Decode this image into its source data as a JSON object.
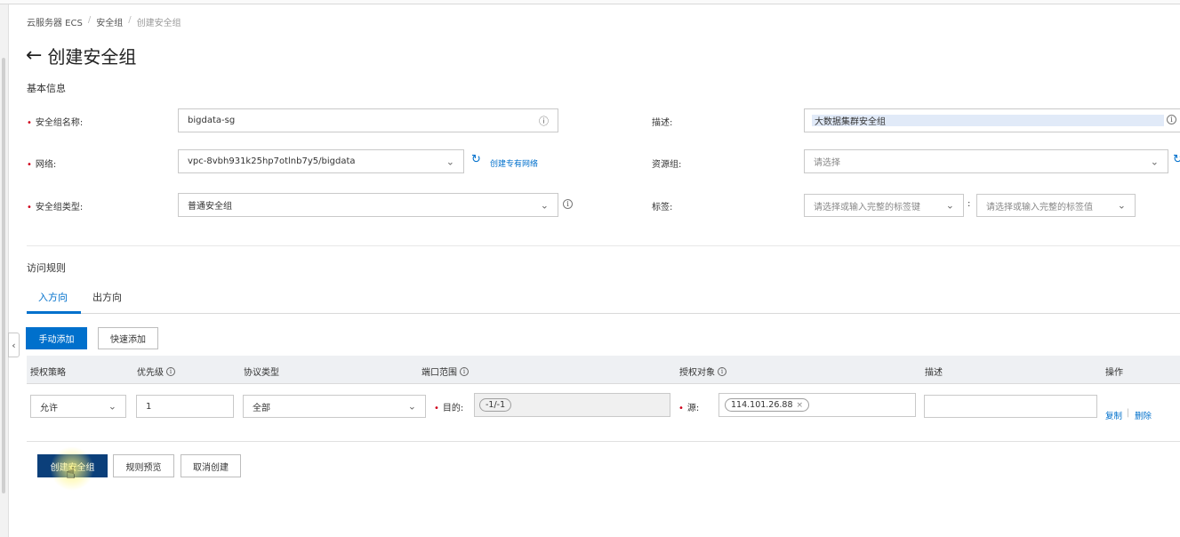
{
  "breadcrumb": {
    "items": [
      "云服务器 ECS",
      "安全组",
      "创建安全组"
    ],
    "separator": "/"
  },
  "page": {
    "back_icon": "arrow-left-icon",
    "title": "创建安全组"
  },
  "basic_info": {
    "section_title": "基本信息",
    "name_label": "安全组名称:",
    "name_value": "bigdata-sg",
    "network_label": "网络:",
    "network_value": "vpc-8vbh931k25hp7otlnb7y5/bigdata",
    "create_vpc_link": "创建专有网络",
    "type_label": "安全组类型:",
    "type_value": "普通安全组",
    "desc_label": "描述:",
    "desc_value": "大数据集群安全组",
    "resource_group_label": "资源组:",
    "resource_group_placeholder": "请选择",
    "tags_label": "标签:",
    "tag_key_placeholder": "请选择或输入完整的标签键",
    "tag_sep": ":",
    "tag_value_placeholder": "请选择或输入完整的标签值"
  },
  "access_rules": {
    "section_title": "访问规则",
    "tabs": [
      {
        "label": "入方向",
        "active": true
      },
      {
        "label": "出方向",
        "active": false
      }
    ],
    "manual_add": "手动添加",
    "quick_add": "快速添加",
    "columns": [
      "授权策略",
      "优先级",
      "协议类型",
      "端口范围",
      "授权对象",
      "描述",
      "操作"
    ],
    "row": {
      "policy": "允许",
      "priority": "1",
      "protocol": "全部",
      "dest_label": "目的:",
      "port_range": "-1/-1",
      "source_label": "源:",
      "source_tag": "114.101.26.88",
      "description": "",
      "actions": [
        "复制",
        "删除"
      ]
    }
  },
  "footer": {
    "create": "创建安全组",
    "preview": "规则预览",
    "cancel": "取消创建"
  },
  "colors": {
    "primary": "#0070cc",
    "dark_primary": "#0b3f7a",
    "required": "#d0021b"
  }
}
